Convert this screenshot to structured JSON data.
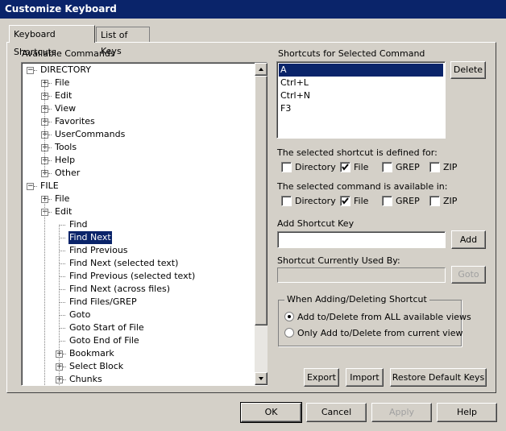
{
  "window": {
    "title": "Customize Keyboard"
  },
  "tabs": [
    {
      "label": "Keyboard Shortcuts",
      "active": true
    },
    {
      "label": "List of Keys",
      "active": false
    }
  ],
  "available": {
    "label": "Available Commands",
    "tree": [
      {
        "label": "DIRECTORY",
        "level": 0,
        "toggle": "-"
      },
      {
        "label": "File",
        "level": 1,
        "toggle": "+"
      },
      {
        "label": "Edit",
        "level": 1,
        "toggle": "+"
      },
      {
        "label": "View",
        "level": 1,
        "toggle": "+"
      },
      {
        "label": "Favorites",
        "level": 1,
        "toggle": "+"
      },
      {
        "label": "UserCommands",
        "level": 1,
        "toggle": "+"
      },
      {
        "label": "Tools",
        "level": 1,
        "toggle": "+"
      },
      {
        "label": "Help",
        "level": 1,
        "toggle": "+"
      },
      {
        "label": "Other",
        "level": 1,
        "toggle": "+"
      },
      {
        "label": "FILE",
        "level": 0,
        "toggle": "-"
      },
      {
        "label": "File",
        "level": 1,
        "toggle": "+"
      },
      {
        "label": "Edit",
        "level": 1,
        "toggle": "-"
      },
      {
        "label": "Find",
        "level": 2,
        "toggle": ""
      },
      {
        "label": "Find Next",
        "level": 2,
        "toggle": "",
        "selected": true
      },
      {
        "label": "Find Previous",
        "level": 2,
        "toggle": ""
      },
      {
        "label": "Find Next (selected text)",
        "level": 2,
        "toggle": ""
      },
      {
        "label": "Find Previous (selected text)",
        "level": 2,
        "toggle": ""
      },
      {
        "label": "Find Next (across files)",
        "level": 2,
        "toggle": ""
      },
      {
        "label": "Find Files/GREP",
        "level": 2,
        "toggle": ""
      },
      {
        "label": "Goto",
        "level": 2,
        "toggle": ""
      },
      {
        "label": "Goto Start of File",
        "level": 2,
        "toggle": ""
      },
      {
        "label": "Goto End of File",
        "level": 2,
        "toggle": ""
      },
      {
        "label": "Bookmark",
        "level": 2,
        "toggle": "+"
      },
      {
        "label": "Select Block",
        "level": 2,
        "toggle": "+"
      },
      {
        "label": "Chunks",
        "level": 2,
        "toggle": "+"
      }
    ]
  },
  "shortcuts": {
    "label": "Shortcuts for Selected Command",
    "items": [
      "A",
      "Ctrl+L",
      "Ctrl+N",
      "F3"
    ],
    "selected_index": 0,
    "delete_label": "Delete"
  },
  "defined_for": {
    "label": "The selected shortcut is defined for:",
    "options": [
      {
        "label": "Directory",
        "checked": false
      },
      {
        "label": "File",
        "checked": true
      },
      {
        "label": "GREP",
        "checked": false
      },
      {
        "label": "ZIP",
        "checked": false
      }
    ]
  },
  "available_in": {
    "label": "The selected command is available in:",
    "options": [
      {
        "label": "Directory",
        "checked": false
      },
      {
        "label": "File",
        "checked": true
      },
      {
        "label": "GREP",
        "checked": false
      },
      {
        "label": "ZIP",
        "checked": false
      }
    ]
  },
  "add_shortcut": {
    "label": "Add Shortcut Key",
    "value": "",
    "button": "Add"
  },
  "used_by": {
    "label": "Shortcut Currently Used By:",
    "value": "",
    "button": "Goto"
  },
  "adding_group": {
    "label": "When Adding/Deleting Shortcut",
    "options": [
      {
        "label": "Add to/Delete from ALL available views",
        "selected": true
      },
      {
        "label": "Only Add to/Delete from current view",
        "selected": false
      }
    ]
  },
  "actions": {
    "export": "Export",
    "import": "Import",
    "restore": "Restore Default Keys"
  },
  "footer": {
    "ok": "OK",
    "cancel": "Cancel",
    "apply": "Apply",
    "help": "Help"
  }
}
